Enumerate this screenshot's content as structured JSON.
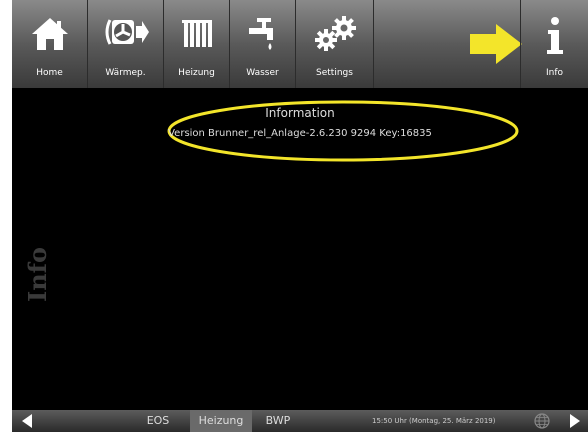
{
  "toolbar": {
    "items": [
      {
        "label": "Home",
        "icon": "home-icon"
      },
      {
        "label": "Wärmep.",
        "icon": "heat-pump-icon"
      },
      {
        "label": "Heizung",
        "icon": "radiator-icon"
      },
      {
        "label": "Wasser",
        "icon": "water-tap-icon"
      },
      {
        "label": "Settings",
        "icon": "gears-icon"
      },
      {
        "label": "Info",
        "icon": "info-icon"
      }
    ]
  },
  "main": {
    "side_label": "Info",
    "info_title": "Information",
    "version_text": "Version Brunner_rel_Anlage-2.6.230 9294 Key:16835"
  },
  "statusbar": {
    "tabs": [
      "EOS",
      "Heizung",
      "BWP"
    ],
    "selected_tab": "Heizung",
    "datetime": "15:50 Uhr (Montag, 25. März 2019)"
  },
  "colors": {
    "highlight": "#f3e52a",
    "background": "#000000",
    "toolbar": "#6a6a6a"
  }
}
